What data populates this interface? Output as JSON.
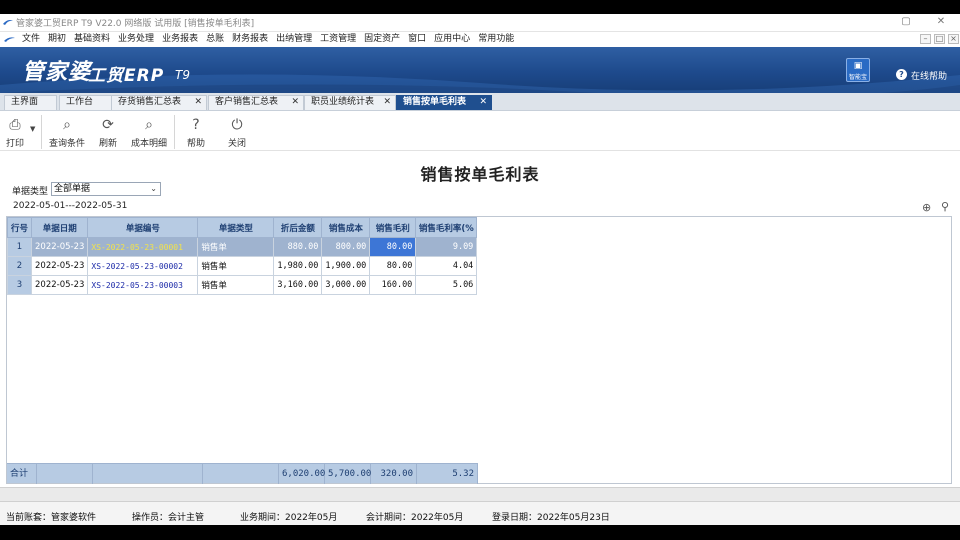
{
  "window": {
    "title": "管家婆工贸ERP T9 V22.0 网络版 试用版 [销售按单毛利表]",
    "min_glyph": "▢",
    "close_glyph": "✕"
  },
  "menu": {
    "items": [
      "文件",
      "期初",
      "基础资料",
      "业务处理",
      "业务报表",
      "总账",
      "财务报表",
      "出纳管理",
      "工资管理",
      "固定资产",
      "窗口",
      "应用中心",
      "常用功能"
    ],
    "min_glyph": "–",
    "restore_glyph": "□",
    "close_glyph": "×"
  },
  "banner": {
    "brand": "管家婆",
    "brand_sub": "工贸ERP",
    "brand_version": "T9",
    "kb_label": "智能宝",
    "help_label": "在线帮助",
    "help_glyph": "?"
  },
  "tabs": [
    {
      "label": "主界面",
      "closable": false
    },
    {
      "label": "工作台",
      "closable": false
    },
    {
      "label": "存货销售汇总表",
      "closable": true
    },
    {
      "label": "客户销售汇总表",
      "closable": true
    },
    {
      "label": "职员业绩统计表",
      "closable": true
    },
    {
      "label": "销售按单毛利表",
      "closable": true,
      "active": true
    }
  ],
  "tab_close_glyph": "✕",
  "toolbar": {
    "print": "打印",
    "query": "查询条件",
    "refresh": "刷新",
    "cost_detail": "成本明细",
    "help": "帮助",
    "close": "关闭"
  },
  "report": {
    "title": "销售按单毛利表",
    "filter_label": "单据类型",
    "filter_value": "全部单据",
    "date_range": "2022-05-01---2022-05-31"
  },
  "table": {
    "columns": [
      "行号",
      "单据日期",
      "单据编号",
      "单据类型",
      "折后金额",
      "销售成本",
      "销售毛利",
      "销售毛利率(%"
    ],
    "rows": [
      {
        "no": "1",
        "date": "2022-05-23",
        "code": "XS-2022-05-23-00001",
        "type": "销售单",
        "amount": "880.00",
        "cost": "800.00",
        "profit": "80.00",
        "rate": "9.09"
      },
      {
        "no": "2",
        "date": "2022-05-23",
        "code": "XS-2022-05-23-00002",
        "type": "销售单",
        "amount": "1,980.00",
        "cost": "1,900.00",
        "profit": "80.00",
        "rate": "4.04"
      },
      {
        "no": "3",
        "date": "2022-05-23",
        "code": "XS-2022-05-23-00003",
        "type": "销售单",
        "amount": "3,160.00",
        "cost": "3,000.00",
        "profit": "160.00",
        "rate": "5.06"
      }
    ],
    "total_label": "合计",
    "totals": {
      "amount": "6,020.00",
      "cost": "5,700.00",
      "profit": "320.00",
      "rate": "5.32"
    }
  },
  "status": {
    "account": "当前账套：管家婆软件",
    "operator": "操作员：会计主管",
    "biz_period": "业务期间：2022年05月",
    "acct_period": "会计期间：2022年05月",
    "login_date": "登录日期：2022年05月23日"
  }
}
